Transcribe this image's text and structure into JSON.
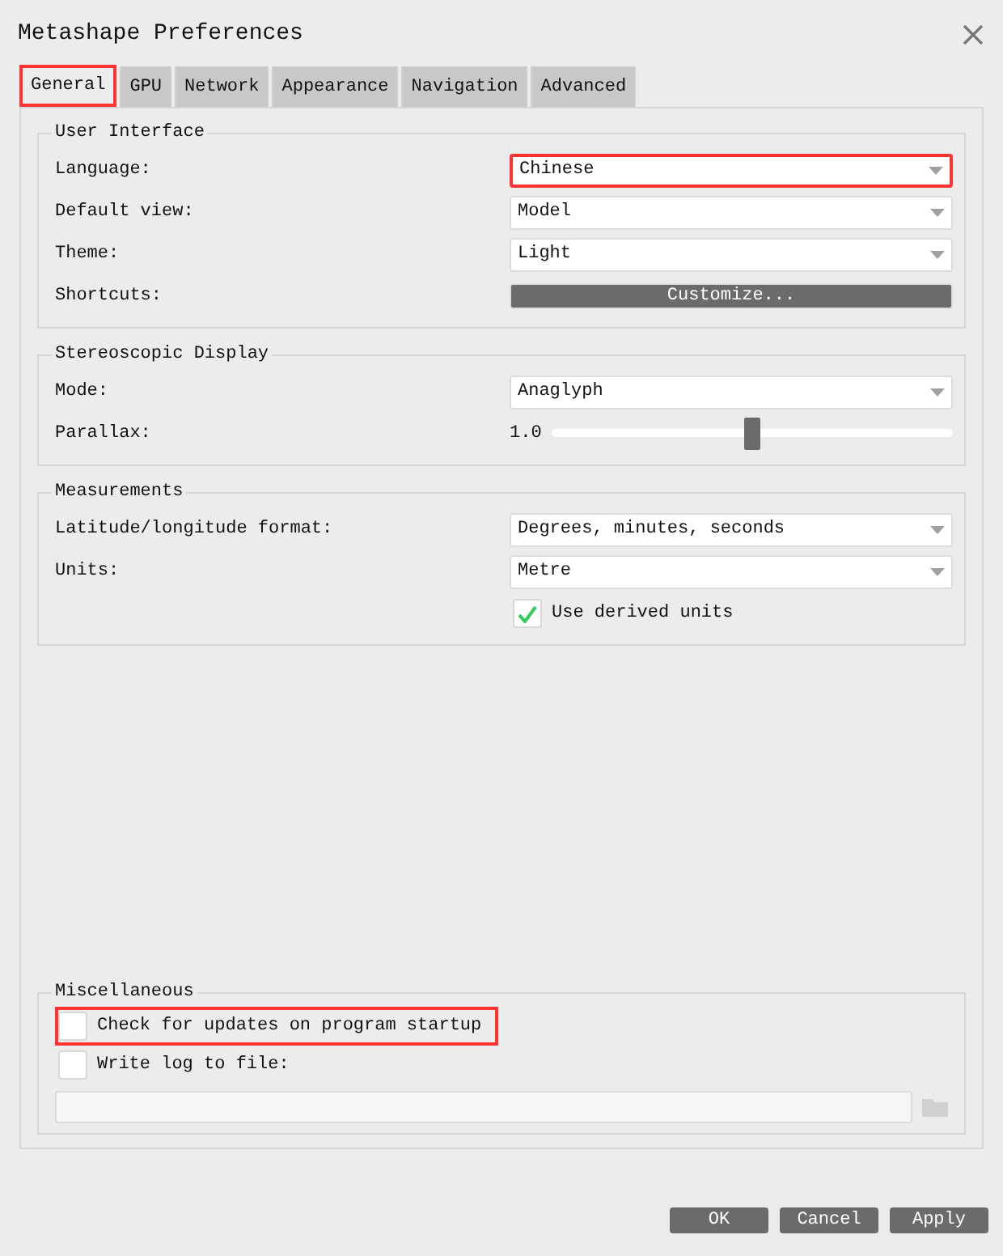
{
  "window": {
    "title": "Metashape Preferences"
  },
  "tabs": [
    {
      "label": "General",
      "selected": true,
      "highlighted": true
    },
    {
      "label": "GPU",
      "selected": false,
      "highlighted": false
    },
    {
      "label": "Network",
      "selected": false,
      "highlighted": false
    },
    {
      "label": "Appearance",
      "selected": false,
      "highlighted": false
    },
    {
      "label": "Navigation",
      "selected": false,
      "highlighted": false
    },
    {
      "label": "Advanced",
      "selected": false,
      "highlighted": false
    }
  ],
  "sections": [
    {
      "title": "User Interface",
      "rows": [
        {
          "kind": "dropdown",
          "label": "Language:",
          "value": "Chinese",
          "highlighted": true
        },
        {
          "kind": "dropdown",
          "label": "Default view:",
          "value": "Model",
          "highlighted": false
        },
        {
          "kind": "dropdown",
          "label": "Theme:",
          "value": "Light",
          "highlighted": false
        },
        {
          "kind": "button",
          "label": "Shortcuts:",
          "value": "Customize...",
          "highlighted": false
        }
      ]
    },
    {
      "title": "Stereoscopic Display",
      "rows": [
        {
          "kind": "dropdown",
          "label": "Mode:",
          "value": "Anaglyph",
          "highlighted": false
        },
        {
          "kind": "slider",
          "label": "Parallax:",
          "value": "1.0",
          "level": 0.5,
          "highlighted": false
        }
      ]
    },
    {
      "title": "Measurements",
      "rows": [
        {
          "kind": "dropdown",
          "label": "Latitude/longitude format:",
          "value": "Degrees, minutes, seconds",
          "highlighted": false
        },
        {
          "kind": "dropdown",
          "label": "Units:",
          "value": "Metre",
          "highlighted": false
        },
        {
          "kind": "checkbox",
          "value": "Use derived units",
          "checked": true,
          "highlighted": false
        }
      ]
    }
  ],
  "miscellaneous": {
    "title": "Miscellaneous",
    "options": [
      {
        "label": "Check for updates on program startup",
        "checked": false,
        "highlighted": true
      },
      {
        "label": "Write log to file:",
        "checked": false,
        "highlighted": false
      }
    ]
  },
  "buttons": [
    {
      "label": "OK"
    },
    {
      "label": "Cancel"
    },
    {
      "label": "Apply"
    }
  ]
}
